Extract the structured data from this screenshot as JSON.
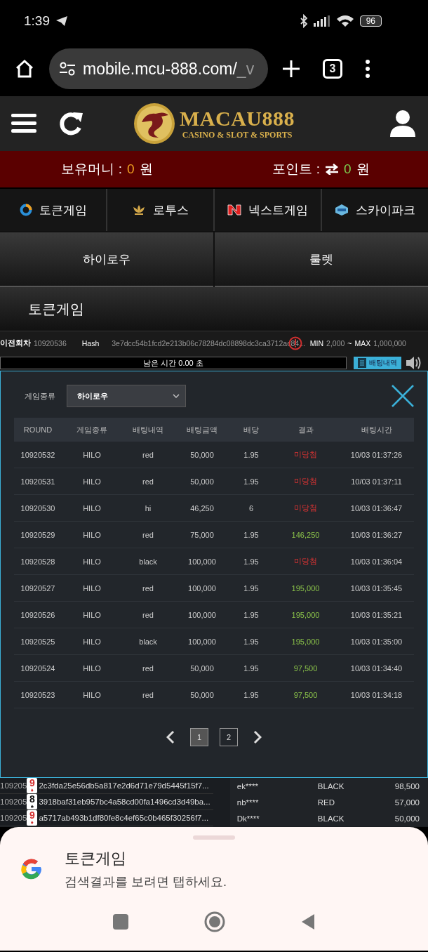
{
  "status_bar": {
    "time": "1:39",
    "battery": "96"
  },
  "browser": {
    "url": "mobile.mcu-888.com/",
    "url_faded": "_v",
    "tab_count": "3"
  },
  "header": {
    "logo_title": "MACAU888",
    "logo_subtitle": "CASINO & SLOT & SPORTS"
  },
  "balance": {
    "money_label": "보유머니 :",
    "money": "0",
    "money_unit": "원",
    "point_label": "포인트 :",
    "point": "0",
    "point_unit": "원"
  },
  "providers": [
    {
      "label": "토큰게임",
      "kind": "token"
    },
    {
      "label": "로투스",
      "kind": "lotus"
    },
    {
      "label": "넥스트게임",
      "kind": "next"
    },
    {
      "label": "스카이파크",
      "kind": "sky"
    }
  ],
  "games": [
    {
      "label": "하이로우"
    },
    {
      "label": "룰렛"
    }
  ],
  "section_title": "토큰게임",
  "info": {
    "prev_label": "이전회차",
    "prev_round": "10920536",
    "hash_label": "Hash",
    "hash": "3e7dcc54b1fcd2e213b06c78284dc08898dc3ca3712ac84...",
    "min_label": "MIN",
    "min": "2,000",
    "tilde": "~",
    "max_label": "MAX",
    "max": "1,000,000"
  },
  "timer": {
    "text": "남은 시간 0.00 초",
    "history_button": "배팅내역"
  },
  "modal": {
    "filter_label": "게임종류",
    "filter_value": "하이로우",
    "columns": [
      "ROUND",
      "게임종류",
      "배팅내역",
      "배팅금액",
      "배당",
      "결과",
      "배팅시간"
    ],
    "rows": [
      {
        "round": "10920532",
        "game": "HILO",
        "bet": "red",
        "amount": "50,000",
        "odds": "1.95",
        "result": "미당첨",
        "won": false,
        "time": "10/03 01:37:26"
      },
      {
        "round": "10920531",
        "game": "HILO",
        "bet": "red",
        "amount": "50,000",
        "odds": "1.95",
        "result": "미당첨",
        "won": false,
        "time": "10/03 01:37:11"
      },
      {
        "round": "10920530",
        "game": "HILO",
        "bet": "hi",
        "amount": "46,250",
        "odds": "6",
        "result": "미당첨",
        "won": false,
        "time": "10/03 01:36:47"
      },
      {
        "round": "10920529",
        "game": "HILO",
        "bet": "red",
        "amount": "75,000",
        "odds": "1.95",
        "result": "146,250",
        "won": true,
        "time": "10/03 01:36:27"
      },
      {
        "round": "10920528",
        "game": "HILO",
        "bet": "black",
        "amount": "100,000",
        "odds": "1.95",
        "result": "미당첨",
        "won": false,
        "time": "10/03 01:36:04"
      },
      {
        "round": "10920527",
        "game": "HILO",
        "bet": "red",
        "amount": "100,000",
        "odds": "1.95",
        "result": "195,000",
        "won": true,
        "time": "10/03 01:35:45"
      },
      {
        "round": "10920526",
        "game": "HILO",
        "bet": "red",
        "amount": "100,000",
        "odds": "1.95",
        "result": "195,000",
        "won": true,
        "time": "10/03 01:35:21"
      },
      {
        "round": "10920525",
        "game": "HILO",
        "bet": "black",
        "amount": "100,000",
        "odds": "1.95",
        "result": "195,000",
        "won": true,
        "time": "10/03 01:35:00"
      },
      {
        "round": "10920524",
        "game": "HILO",
        "bet": "red",
        "amount": "50,000",
        "odds": "1.95",
        "result": "97,500",
        "won": true,
        "time": "10/03 01:34:40"
      },
      {
        "round": "10920523",
        "game": "HILO",
        "bet": "red",
        "amount": "50,000",
        "odds": "1.95",
        "result": "97,500",
        "won": true,
        "time": "10/03 01:34:18"
      }
    ],
    "pages": [
      {
        "label": "1",
        "selected": true
      },
      {
        "label": "2",
        "selected": false
      }
    ]
  },
  "history": [
    {
      "round": "109205",
      "card": "9",
      "suit": "♦",
      "color": "#d32f2f",
      "hash": "2c3fda25e56db5a817e2d6d71e79d5445f15f7...",
      "user": "ek****",
      "pick": "BLACK",
      "amount": "98,500"
    },
    {
      "round": "109205",
      "card": "8",
      "suit": "♠",
      "color": "#111111",
      "hash": "3918baf31eb957bc4a58cd00fa1496cd3d49ba...",
      "user": "nb****",
      "pick": "RED",
      "amount": "57,000"
    },
    {
      "round": "109205",
      "card": "9",
      "suit": "♦",
      "color": "#d32f2f",
      "hash": "a5717ab493b1df80fe8c4ef65c0b465f30256f7...",
      "user": "Dk****",
      "pick": "BLACK",
      "amount": "50,000"
    }
  ],
  "sheet": {
    "title": "토큰게임",
    "subtitle": "검색결과를 보려면 탭하세요."
  }
}
